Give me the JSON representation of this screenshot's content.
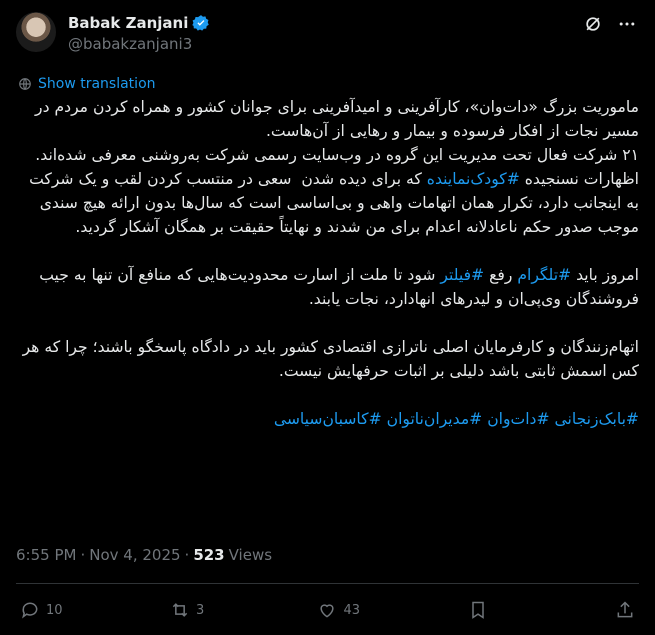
{
  "author": {
    "display_name": "Babak Zanjani",
    "handle": "@babakzanjani3"
  },
  "translate_label": "Show translation",
  "tweet": {
    "p1": "ماموریت بزرگ «دات‌وان»، کارآفرینی و امیدآفرینی برای جوانان کشور و همراه کردن مردم در مسیر نجات از افکار فرسوده و بیمار و رهایی از آن‌هاست.\n۲۱ شرکت فعال تحت مدیریت این گروه در وب‌سایت رسمی شرکت به‌روشنی معرفی شده‌اند.",
    "p2a": "اظهارات نسنجیده ",
    "p2_tag": "#کودک‌نماینده",
    "p2b": " که برای دیده شدن  سعی در منتسب کردن لقب و یک شرکت به اینجانب دارد، تکرار همان اتهامات واهی و بی‌اساسی است که سال‌ها بدون ارائه هیچ سندی موجب صدور حکم ناعادلانه اعدام برای من شدند و نهایتاً حقیقت بر همگان آشکار گردید.",
    "p3a": "امروز باید ",
    "p3_tag1": "#تلگرام",
    "p3b": " رفع ",
    "p3_tag2": "#فیلتر",
    "p3c": " شود تا ملت از اسارت محدودیت‌هایی که منافع آن تنها به جیب فروشندگان وی‌پی‌ان و لیدرهای انهادارد، نجات یابند.",
    "p4": "اتهام‌زنندگان و کارفرمایان اصلی ناترازی اقتصادی کشور باید در دادگاه پاسخگو باشند؛ چرا که هر کس اسمش ثابتی باشد دلیلی بر اثبات حرفهایش نیست.",
    "hashtags": "#بابک‌زنجانی #دات‌وان #مدیران‌ناتوان #کاسبان‌سیاسی"
  },
  "meta": {
    "time": "6:55 PM",
    "sep1": "·",
    "date": "Nov 4, 2025",
    "sep2": "·",
    "views_count": "523",
    "views_label": "Views"
  },
  "actions": {
    "replies": "10",
    "reposts": "3",
    "likes": "43",
    "bookmarks": ""
  },
  "colors": {
    "background": "#000000",
    "text": "#e7e9ea",
    "muted": "#71767b",
    "link": "#1d9bf0"
  }
}
